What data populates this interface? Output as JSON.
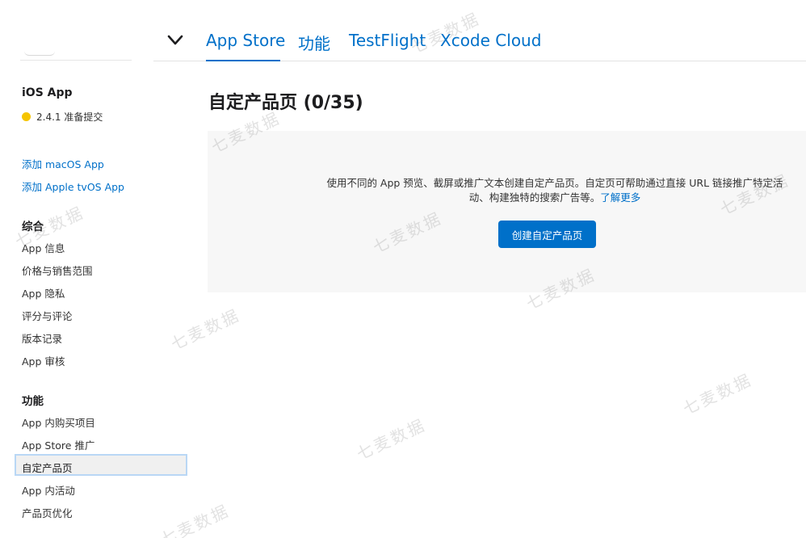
{
  "sidebar": {
    "app_platform": "iOS App",
    "version_status": "2.4.1 准备提交",
    "status_color": "#f5c400",
    "add_links": [
      "添加 macOS App",
      "添加 Apple tvOS App"
    ],
    "sections": [
      {
        "heading": "综合",
        "items": [
          "App 信息",
          "价格与销售范围",
          "App 隐私",
          "评分与评论",
          "版本记录",
          "App 审核"
        ]
      },
      {
        "heading": "功能",
        "items": [
          "App 内购买项目",
          "App Store 推广",
          "自定产品页",
          "App 内活动",
          "产品页优化"
        ]
      }
    ],
    "selected_item": "自定产品页"
  },
  "header": {
    "collapse_icon": "chevron-down-icon",
    "tabs": [
      "App Store",
      "功能",
      "TestFlight",
      "Xcode Cloud"
    ],
    "active_tab": "App Store",
    "accent_color": "#0070c9"
  },
  "main": {
    "title": "自定产品页 (0/35)",
    "empty_state": {
      "line1": "使用不同的 App 预览、截屏或推广文本创建自定产品页。自定页可帮助通过直接 URL 链接推广特定活",
      "line2": "动、构建独特的搜索广告等。",
      "learn_more": "了解更多",
      "button_label": "创建自定产品页"
    }
  },
  "watermark": {
    "text": "七麦数据"
  }
}
